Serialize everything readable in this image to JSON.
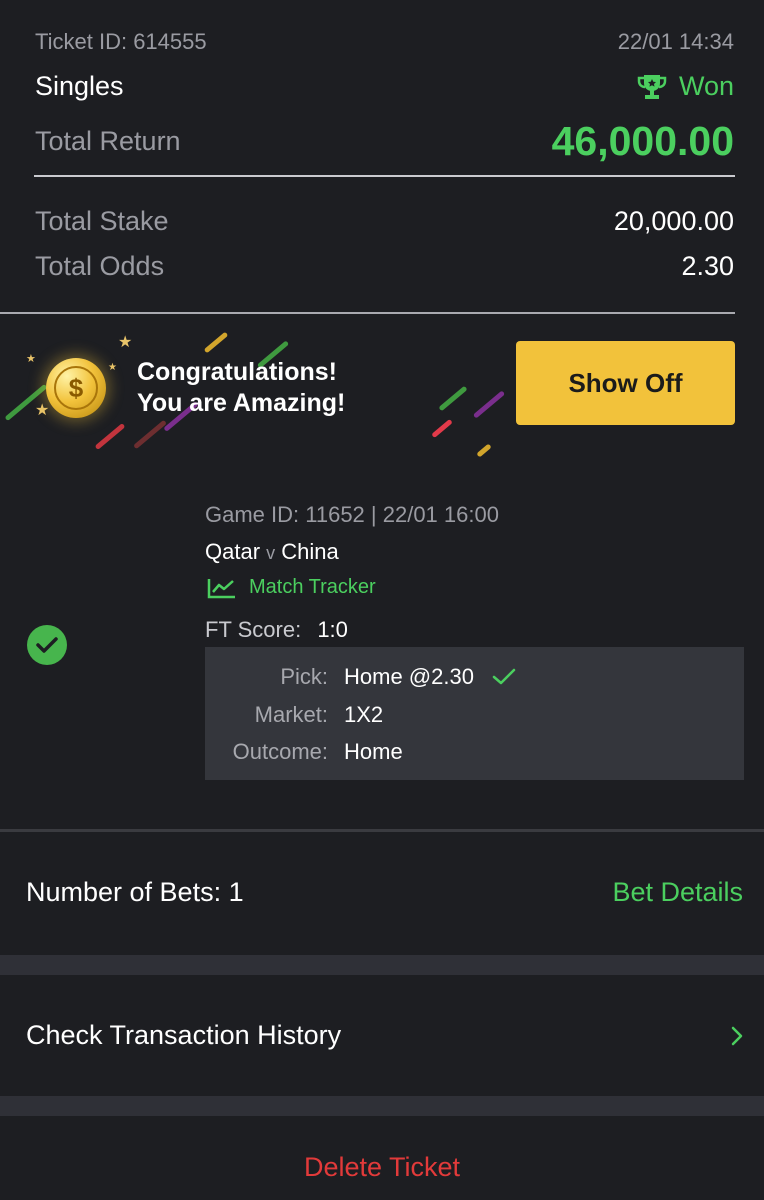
{
  "ticket": {
    "id_label": "Ticket ID: 614555",
    "datetime": "22/01 14:34",
    "type": "Singles",
    "status": "Won",
    "total_return_label": "Total Return",
    "total_return_value": "46,000.00",
    "total_stake_label": "Total Stake",
    "total_stake_value": "20,000.00",
    "total_odds_label": "Total Odds",
    "total_odds_value": "2.30"
  },
  "banner": {
    "line1": "Congratulations!",
    "line2": "You are Amazing!",
    "coin_symbol": "$",
    "show_off_label": "Show Off"
  },
  "game": {
    "id_line": "Game ID: 11652 | 22/01 16:00",
    "home_team": "Qatar",
    "vs": "v",
    "away_team": "China",
    "tracker_label": "Match Tracker",
    "ft_label": "FT Score:",
    "ft_value": "1:0",
    "pick_label": "Pick:",
    "pick_value": "Home @2.30",
    "market_label": "Market:",
    "market_value": "1X2",
    "outcome_label": "Outcome:",
    "outcome_value": "Home"
  },
  "footer": {
    "bets_label": "Number of Bets: 1",
    "bet_details_label": "Bet Details",
    "transaction_label": "Check Transaction History",
    "delete_label": "Delete Ticket"
  },
  "colors": {
    "accent_green": "#4bcf5f",
    "button_yellow": "#f2c23b",
    "delete_red": "#e23a3a",
    "background": "#1d1e22"
  },
  "icons": [
    "trophy-icon",
    "coin-icon",
    "star-icon",
    "check-circle-icon",
    "chart-icon",
    "check-mark-icon",
    "chevron-right-icon"
  ]
}
